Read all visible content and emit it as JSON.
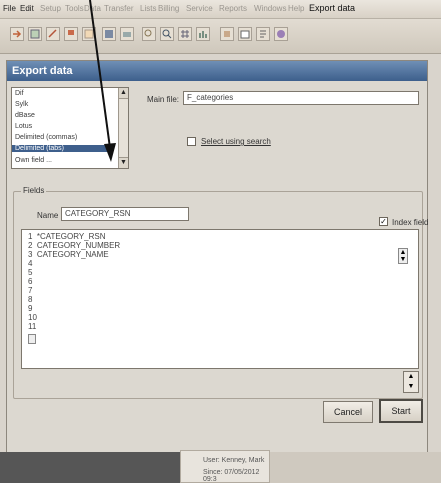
{
  "menubar": {
    "items": [
      "File",
      "Edit",
      "Setup",
      "Tools",
      "Data",
      "Transfer",
      "Lists",
      "Billing",
      "Service",
      "Reports",
      "Windows",
      "Help"
    ],
    "active": "Export data"
  },
  "window": {
    "title": "Export data",
    "format_list": [
      "Dif",
      "Sylk",
      "dBase",
      "Lotus",
      "Delimited (commas)",
      "Delimited (tabs)",
      "Own field ..."
    ],
    "format_selected": "Delimited (tabs)",
    "main_file_label": "Main file:",
    "main_file_value": "F_categories",
    "select_search_label": "Select using search",
    "fields_group_label": "Fields",
    "name_label": "Name",
    "name_value": "CATEGORY_RSN",
    "index_field_label": "Index field",
    "field_lines": [
      {
        "num": "1",
        "text": "*CATEGORY_RSN"
      },
      {
        "num": "2",
        "text": "CATEGORY_NUMBER"
      },
      {
        "num": "3",
        "text": "CATEGORY_NAME"
      },
      {
        "num": "4",
        "text": ""
      },
      {
        "num": "5",
        "text": ""
      },
      {
        "num": "6",
        "text": ""
      },
      {
        "num": "7",
        "text": ""
      },
      {
        "num": "8",
        "text": ""
      },
      {
        "num": "9",
        "text": ""
      },
      {
        "num": "10",
        "text": ""
      },
      {
        "num": "11",
        "text": ""
      }
    ],
    "cancel_label": "Cancel",
    "start_label": "Start"
  },
  "status": {
    "user": "User: Kenney, Mark",
    "since": "Since: 07/05/2012 09:3"
  },
  "colors": {
    "titlebar": "#3d5f8c",
    "selection": "#3e5f8c"
  }
}
